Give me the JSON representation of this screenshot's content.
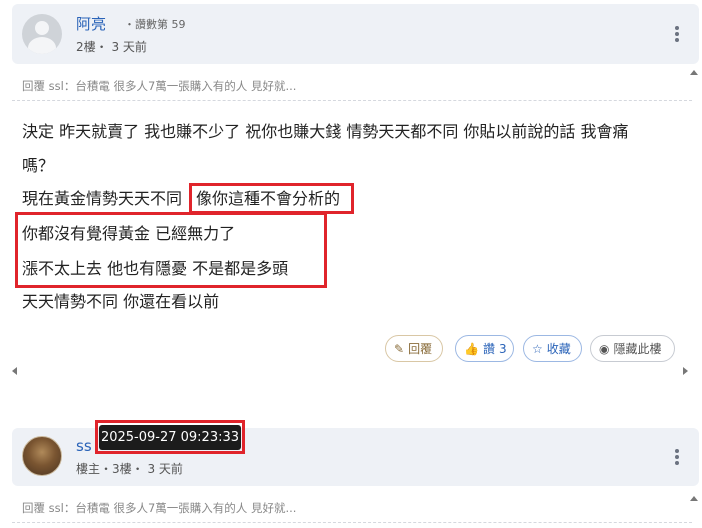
{
  "post1": {
    "username": "阿亮",
    "user_extra": "・讚數第 59",
    "meta": "2樓・ 3 天前",
    "quote": "回覆 ssl：台積電 很多人7萬一張購入有的人 見好就...",
    "body": {
      "line1": "決定 昨天就賣了  我也賺不少了 祝你也賺大錢 情勢天天都不同 你貼以前說的話 我會痛",
      "line2": "嗎？",
      "line3a": "現在黃金情勢天天不同",
      "line3b": "像你這種不會分析的",
      "line4": "你都沒有覺得黃金 已經無力了",
      "line5": "漲不太上去 他也有隱憂 不是都是多頭",
      "line6": "天天情勢不同 你還在看以前"
    },
    "actions": {
      "reply": "回覆",
      "like": "讚",
      "like_count": "3",
      "favorite": "收藏",
      "hide": "隱藏此樓"
    }
  },
  "post2": {
    "username": "ss",
    "meta": "樓主・3樓・ 3 天前",
    "quote": "回覆 ssl：台積電 很多人7萬一張購入有的人 見好就...",
    "tooltip": "2025-09-27 09:23:33"
  },
  "colors": {
    "highlight_box": "#e0242b",
    "username": "#2a63b8",
    "header_bg": "#eef1f6"
  }
}
